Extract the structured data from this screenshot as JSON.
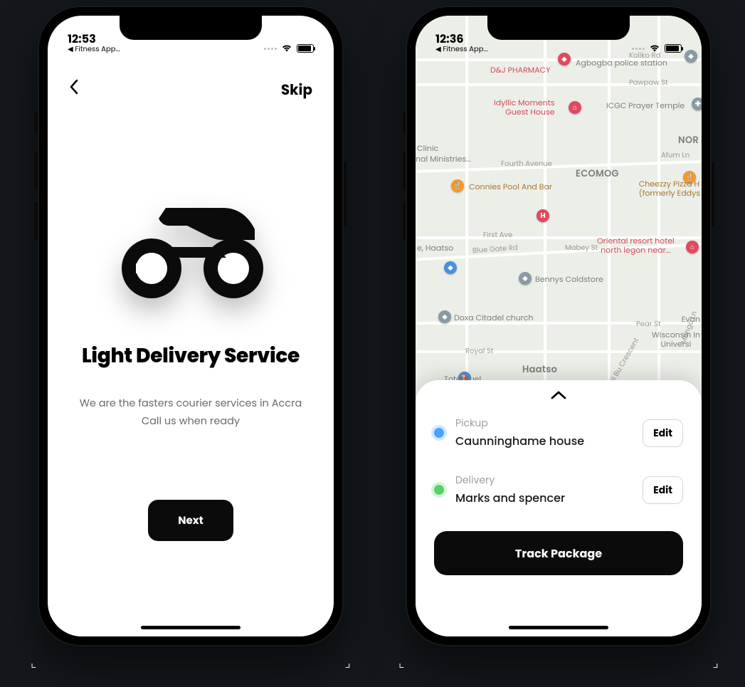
{
  "screen1": {
    "status": {
      "time": "12:53",
      "back_app": "◀ Fitness App..."
    },
    "nav": {
      "skip": "Skip"
    },
    "title": "Light Delivery Service",
    "subtitle_line1": "We are the fasters courier services in Accra",
    "subtitle_line2": "Call us when ready",
    "next": "Next"
  },
  "screen2": {
    "status": {
      "time": "12:36",
      "back_app": "◀ Fitness App..."
    },
    "map": {
      "roads": {
        "koliko": "Koliko Rd",
        "pawpaw": "Pawpaw St",
        "fourth": "Fourth Avenue",
        "first": "First Ave",
        "bluegate": "Blue Gate Rd",
        "mabey": "Mabey St",
        "pear": "Pear St",
        "royal": "Royal St",
        "afum": "Afum Ln",
        "mango": "Mango Ln",
        "niibu": "Nii Bu Crescent"
      },
      "areas": {
        "ecomog": "ECOMOG",
        "nor": "NOR",
        "haatso": "Haatso",
        "haatso2": "e, Haatso"
      },
      "places": {
        "dj": "D&J PHARMACY",
        "police": "Agbogba police station",
        "idyllic1": "Idyllic Moments",
        "idyllic2": "Guest House",
        "icgc": "ICGC Prayer Temple",
        "clinic": "Clinic",
        "ministries": "nal Ministries...",
        "connies": "Connies Pool And Bar",
        "cheezzy1": "Cheezzy Pizza H",
        "cheezzy2": "(formerly Eddys",
        "oriental1": "Oriental resort hotel",
        "oriental2": "north legon near...",
        "bennys": "Bennys Coldstore",
        "doxa": "Doxa Citadel church",
        "evan": "Evan",
        "wisc1": "Wisconsin In",
        "wisc2": "Universi",
        "totalfuel": "Total Fuel"
      }
    },
    "sheet": {
      "pickup_label": "Pickup",
      "pickup_value": "Caunninghame house",
      "delivery_label": "Delivery",
      "delivery_value": "Marks and spencer",
      "edit": "Edit",
      "track": "Track Package"
    }
  }
}
